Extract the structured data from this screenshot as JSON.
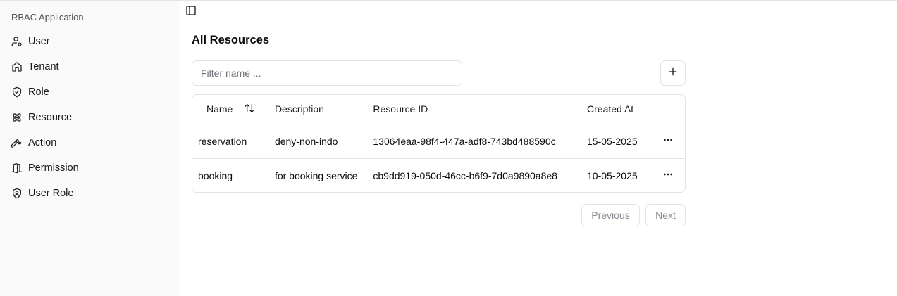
{
  "sidebar": {
    "title": "RBAC Application",
    "items": [
      {
        "label": "User",
        "icon": "user-cog-icon"
      },
      {
        "label": "Tenant",
        "icon": "home-icon"
      },
      {
        "label": "Role",
        "icon": "shield-check-icon"
      },
      {
        "label": "Resource",
        "icon": "atom-icon"
      },
      {
        "label": "Action",
        "icon": "wrench-icon"
      },
      {
        "label": "Permission",
        "icon": "door-open-icon"
      },
      {
        "label": "User Role",
        "icon": "shield-user-icon"
      }
    ]
  },
  "main": {
    "title": "All Resources",
    "filter": {
      "placeholder": "Filter name ...",
      "value": ""
    },
    "table": {
      "columns": [
        "Name",
        "Description",
        "Resource ID",
        "Created At"
      ],
      "rows": [
        {
          "name": "reservation",
          "description": "deny-non-indo",
          "resource_id": "13064eaa-98f4-447a-adf8-743bd488590c",
          "created_at": "15-05-2025"
        },
        {
          "name": "booking",
          "description": "for booking service",
          "resource_id": "cb9dd919-050d-46cc-b6f9-7d0a9890a8e8",
          "created_at": "10-05-2025"
        }
      ]
    },
    "pagination": {
      "previous": "Previous",
      "next": "Next"
    }
  }
}
